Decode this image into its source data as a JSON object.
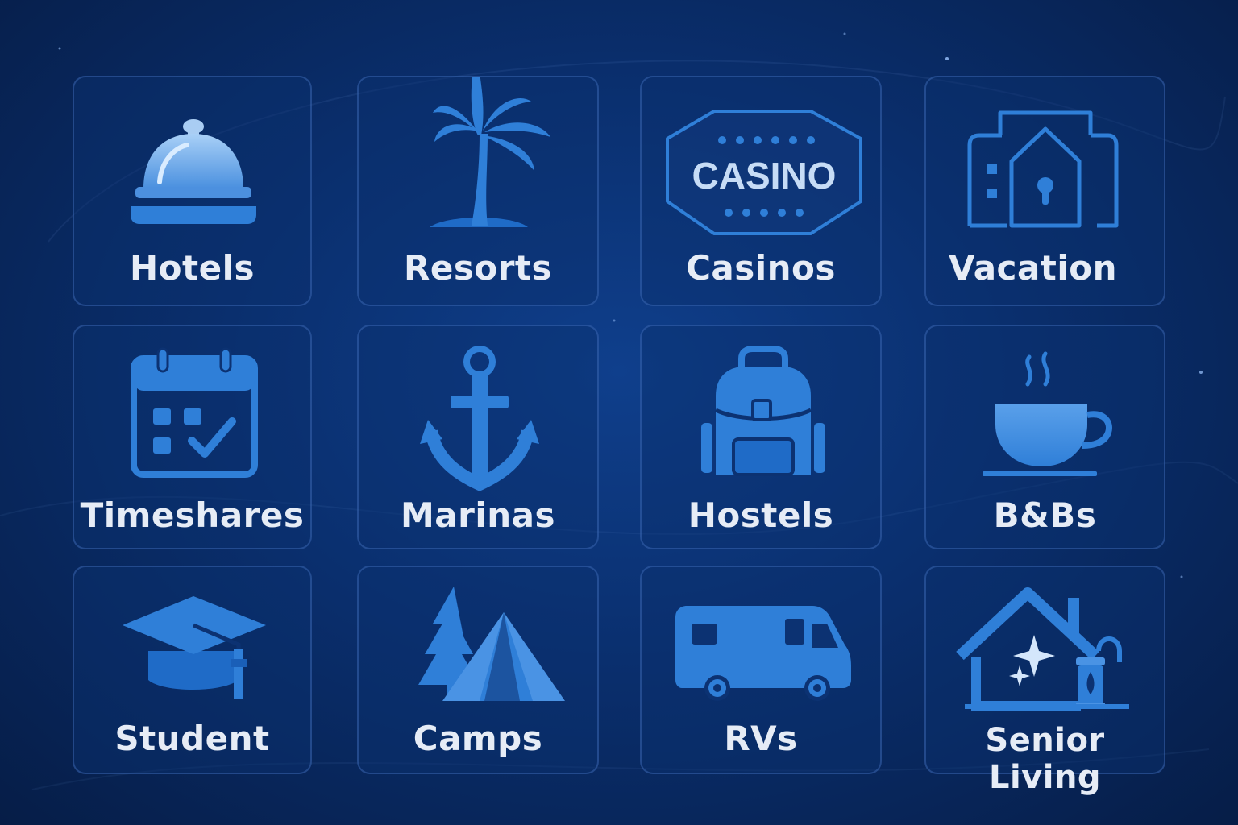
{
  "categories": [
    {
      "label": "Hotels",
      "icon": "hotel-bell-icon"
    },
    {
      "label": "Resorts",
      "icon": "palm-tree-icon"
    },
    {
      "label": "Casinos",
      "icon": "casino-sign-icon",
      "sign_text": "CASINO"
    },
    {
      "label": "Vacation",
      "icon": "vacation-house-icon"
    },
    {
      "label": "Timeshares",
      "icon": "calendar-check-icon"
    },
    {
      "label": "Marinas",
      "icon": "anchor-icon"
    },
    {
      "label": "Hostels",
      "icon": "backpack-icon"
    },
    {
      "label": "B&Bs",
      "icon": "coffee-cup-icon"
    },
    {
      "label": "Student",
      "icon": "graduation-cap-icon"
    },
    {
      "label": "Camps",
      "icon": "tent-tree-icon"
    },
    {
      "label": "RVs",
      "icon": "rv-icon"
    },
    {
      "label": "Senior Living",
      "icon": "home-sparkle-lantern-icon"
    }
  ],
  "colors": {
    "background": "#0a2f6e",
    "icon_primary": "#2f7fd8",
    "icon_light": "#7fb6f0",
    "label": "#e6ecf6",
    "tile_border": "#3f6fc0"
  }
}
